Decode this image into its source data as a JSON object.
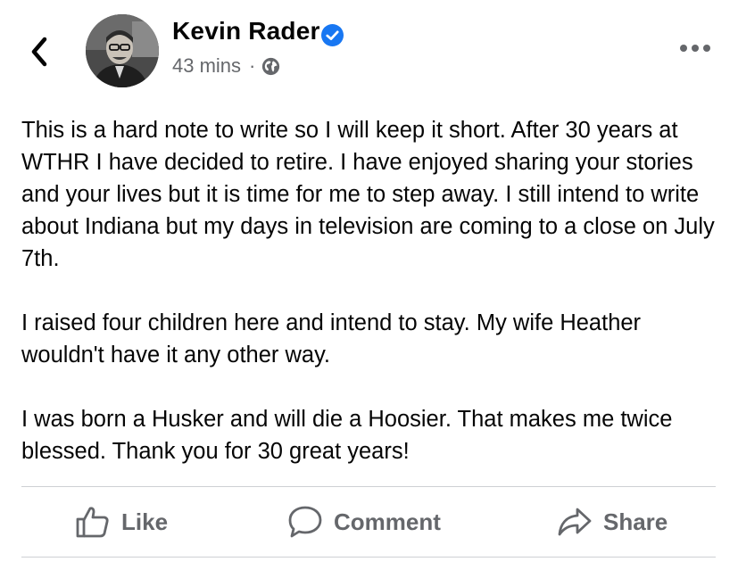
{
  "post": {
    "author": "Kevin Rader",
    "verified": true,
    "time": "43 mins",
    "separator": "·",
    "audience_icon": "globe-icon",
    "paragraphs": [
      "This is a hard note to write so I will keep it short.  After 30 years at WTHR I have decided to retire.  I have enjoyed sharing your stories and your lives but it is time for me to step away.  I still intend to write about Indiana but my days in television are coming to a close on July 7th.",
      "I raised four children here and intend to stay.  My wife Heather wouldn't have it any other way.",
      "I was born a Husker and will die a Hoosier.  That makes me twice blessed.  Thank you for 30 great years!"
    ]
  },
  "actions": {
    "like": "Like",
    "comment": "Comment",
    "share": "Share"
  },
  "colors": {
    "text": "#050505",
    "secondary": "#65676b",
    "verified": "#1877f2",
    "divider": "#ced0d4"
  }
}
